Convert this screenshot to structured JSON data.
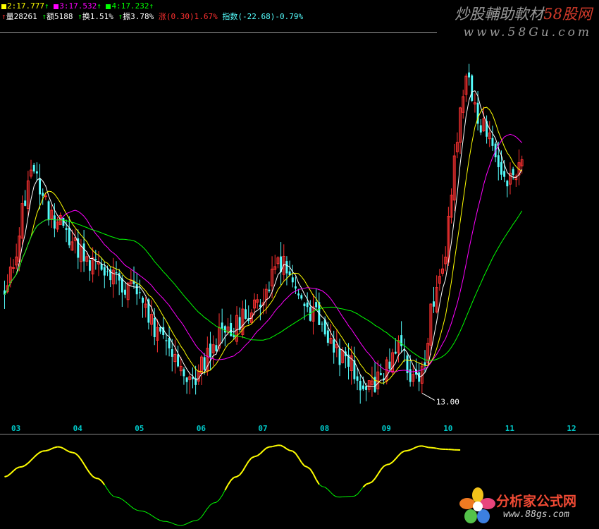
{
  "header": {
    "ma2_label": "2:17.777",
    "ma3_label": "3:17.532",
    "ma4_label": "4:17.232",
    "vol_label": "量28261",
    "amt_label": "额5188",
    "turn_label": "换1.51%",
    "amp_label": "振3.78%",
    "chg_label": "涨(0.30)1.67%",
    "idx_label": "指数(-22.68)-0.79%"
  },
  "watermark_top": {
    "brand": "炒股輔助軟材",
    "brand_accent": "58股网",
    "url": "www.58Gu.com"
  },
  "watermark_bottom": {
    "brand": "分析家公式网",
    "url": "www.88gs.com"
  },
  "colors": {
    "background": "#000000",
    "bull": "#ff3232",
    "bear": "#54fcfc",
    "ma_short": "#ffffff",
    "ma_mid": "#ffff00",
    "ma_long1": "#ff00ff",
    "ma_long2": "#00ff00",
    "axis_label": "#00c8c8",
    "osc_high": "#ffff00",
    "osc_low": "#00ff00"
  },
  "chart_data": [
    {
      "type": "candlestick",
      "x_ticks": [
        "03",
        "04",
        "05",
        "06",
        "07",
        "08",
        "09",
        "10",
        "11",
        "12"
      ],
      "annotation": "13.00",
      "ylim": [
        12.5,
        21.5
      ],
      "keypoints": [
        {
          "m": 2.8,
          "p": 15.6
        },
        {
          "m": 3.25,
          "p": 18.1
        },
        {
          "m": 3.7,
          "p": 17.0
        },
        {
          "m": 4.2,
          "p": 16.1
        },
        {
          "m": 4.9,
          "p": 15.6
        },
        {
          "m": 5.3,
          "p": 14.6
        },
        {
          "m": 5.8,
          "p": 13.4
        },
        {
          "m": 6.3,
          "p": 14.4
        },
        {
          "m": 6.9,
          "p": 15.1
        },
        {
          "m": 7.3,
          "p": 16.2
        },
        {
          "m": 7.7,
          "p": 15.1
        },
        {
          "m": 8.2,
          "p": 14.0
        },
        {
          "m": 8.7,
          "p": 13.3
        },
        {
          "m": 9.2,
          "p": 14.1
        },
        {
          "m": 9.5,
          "p": 13.3
        },
        {
          "m": 9.8,
          "p": 15.5
        },
        {
          "m": 10.3,
          "p": 20.3
        },
        {
          "m": 10.6,
          "p": 19.2
        },
        {
          "m": 11.0,
          "p": 18.0
        },
        {
          "m": 11.2,
          "p": 18.4
        }
      ],
      "series": [
        {
          "name": "2"
        },
        {
          "name": "3"
        },
        {
          "name": "4"
        }
      ]
    },
    {
      "type": "line",
      "keypoints": [
        {
          "m": 2.8,
          "v": 0.6
        },
        {
          "m": 3.05,
          "v": 0.72
        },
        {
          "m": 3.45,
          "v": 0.92
        },
        {
          "m": 3.67,
          "v": 0.97
        },
        {
          "m": 3.9,
          "v": 0.9
        },
        {
          "m": 4.3,
          "v": 0.58
        },
        {
          "m": 4.6,
          "v": 0.35
        },
        {
          "m": 5.0,
          "v": 0.18
        },
        {
          "m": 5.4,
          "v": 0.05
        },
        {
          "m": 5.65,
          "v": 0.0
        },
        {
          "m": 5.9,
          "v": 0.06
        },
        {
          "m": 6.2,
          "v": 0.28
        },
        {
          "m": 6.55,
          "v": 0.6
        },
        {
          "m": 6.85,
          "v": 0.85
        },
        {
          "m": 7.1,
          "v": 0.97
        },
        {
          "m": 7.25,
          "v": 0.99
        },
        {
          "m": 7.45,
          "v": 0.92
        },
        {
          "m": 7.7,
          "v": 0.72
        },
        {
          "m": 7.95,
          "v": 0.48
        },
        {
          "m": 8.2,
          "v": 0.35
        },
        {
          "m": 8.45,
          "v": 0.36
        },
        {
          "m": 8.7,
          "v": 0.52
        },
        {
          "m": 9.0,
          "v": 0.75
        },
        {
          "m": 9.3,
          "v": 0.92
        },
        {
          "m": 9.55,
          "v": 0.98
        },
        {
          "m": 9.7,
          "v": 0.96
        },
        {
          "m": 9.9,
          "v": 0.94
        },
        {
          "m": 10.2,
          "v": 0.93
        }
      ]
    }
  ]
}
